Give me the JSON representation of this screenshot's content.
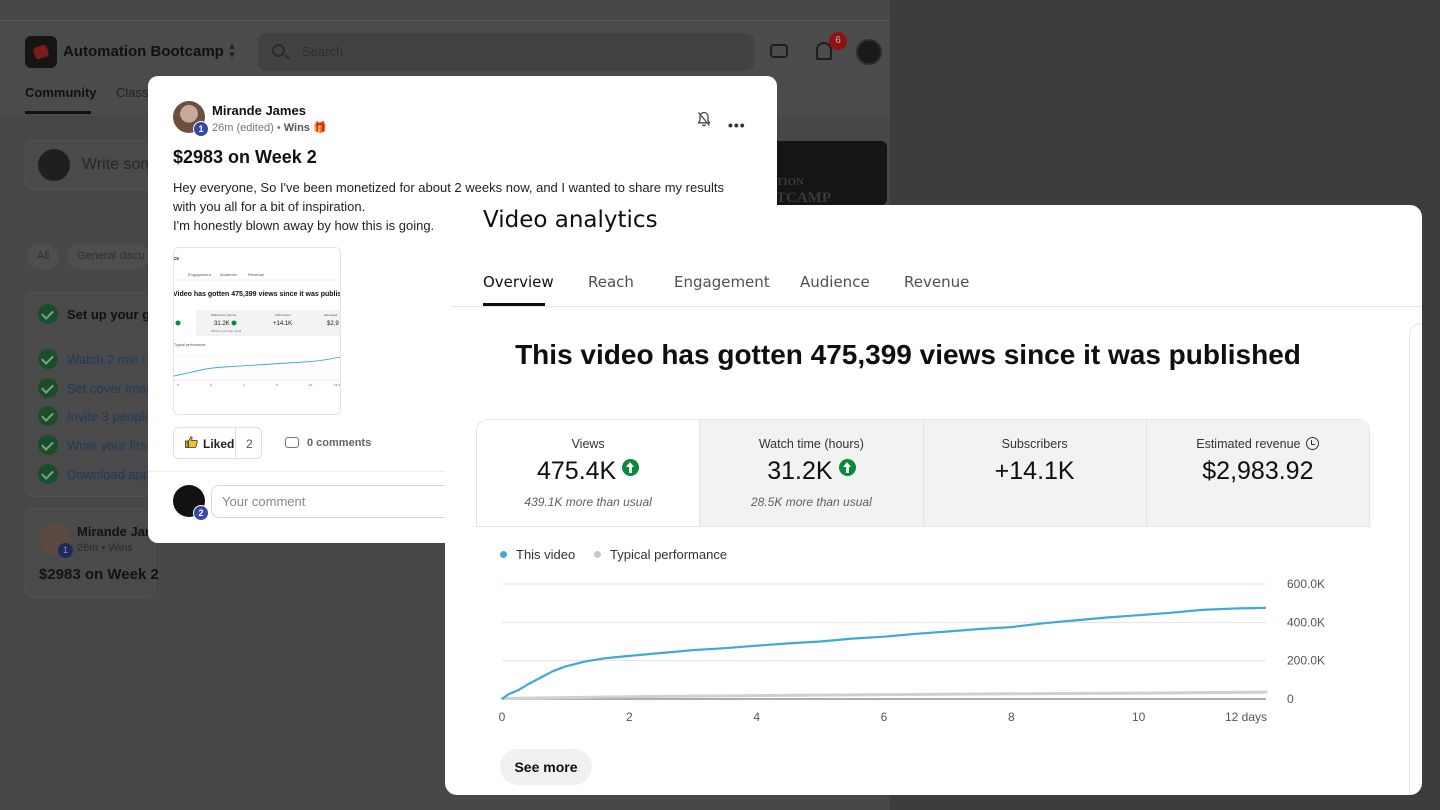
{
  "app": {
    "group_name": "Automation Bootcamp",
    "search_placeholder": "Search",
    "notification_count": "6",
    "nav": [
      "Community",
      "Class"
    ],
    "write_prompt": "Write som",
    "banner_lines": [
      "TION",
      "TCAMP"
    ],
    "filter_chips": [
      "All",
      "General discu"
    ],
    "checklist_title": "Set up your gr",
    "checklist_tasks": [
      "Watch 2 min i",
      "Set cover imag",
      "Invite 3 people",
      "Write your first",
      "Download app"
    ],
    "bg_post": {
      "author": "Mirande Jam",
      "meta": "26m • Wins",
      "level": "1",
      "title": "$2983 on Week 2"
    }
  },
  "post": {
    "author": "Mirande James",
    "level": "1",
    "meta_time": "26m (edited)",
    "meta_sep": " • ",
    "meta_category": "Wins",
    "title": "$2983 on Week 2",
    "body_lines": [
      "Hey everyone, So I've been monetized for about 2 weeks now, and I wanted to share my results with you all for a bit of inspiration.",
      "I'm honestly blown away by how this is going."
    ],
    "like_label": "Liked",
    "like_count": "2",
    "comments_label": "0 comments",
    "my_level": "2",
    "comment_placeholder": "Your comment"
  },
  "analytics": {
    "title": "Video analytics",
    "tabs": [
      "Overview",
      "Reach",
      "Engagement",
      "Audience",
      "Revenue"
    ],
    "active_tab": "Overview",
    "headline": "This video has gotten 475,399 views since it was published",
    "metrics": [
      {
        "label": "Views",
        "value": "475.4K",
        "sub": "439.1K more than usual",
        "trend": "up"
      },
      {
        "label": "Watch time (hours)",
        "value": "31.2K",
        "sub": "28.5K more than usual",
        "trend": "up"
      },
      {
        "label": "Subscribers",
        "value": "+14.1K",
        "sub": "",
        "trend": ""
      },
      {
        "label": "Estimated revenue",
        "value": "$2,983.92",
        "sub": "",
        "trend": ""
      }
    ],
    "see_more": "See more",
    "colors": {
      "series": "#40a9d6",
      "typical": "#d0d0d0",
      "up": "#0a8a3c"
    }
  },
  "chart_data": {
    "type": "line",
    "legend": [
      "This video",
      "Typical performance"
    ],
    "x_ticks": [
      "0",
      "2",
      "4",
      "6",
      "8",
      "10",
      "12 days"
    ],
    "y_ticks": [
      "0",
      "200.0K",
      "400.0K",
      "600.0K"
    ],
    "xlim": [
      0,
      12
    ],
    "ylim": [
      0,
      600000
    ],
    "grid": true,
    "legend_position": "top-left",
    "series": [
      {
        "name": "This video",
        "x": [
          0,
          0.1,
          0.25,
          0.4,
          0.6,
          0.8,
          1,
          1.3,
          1.6,
          2,
          2.5,
          3,
          3.5,
          4,
          4.5,
          5,
          5.5,
          6,
          6.5,
          7,
          7.5,
          8,
          8.5,
          9,
          9.5,
          10,
          10.5,
          11,
          11.5,
          12
        ],
        "y": [
          0,
          25000,
          45000,
          75000,
          110000,
          145000,
          170000,
          195000,
          212000,
          225000,
          240000,
          255000,
          265000,
          278000,
          290000,
          300000,
          315000,
          325000,
          340000,
          352000,
          365000,
          375000,
          395000,
          410000,
          425000,
          437000,
          450000,
          465000,
          472000,
          475399
        ]
      },
      {
        "name": "Typical performance",
        "x": [
          0,
          2,
          4,
          6,
          8,
          10,
          12
        ],
        "y": [
          3000,
          12000,
          18000,
          23000,
          27000,
          31000,
          36000
        ]
      }
    ]
  }
}
